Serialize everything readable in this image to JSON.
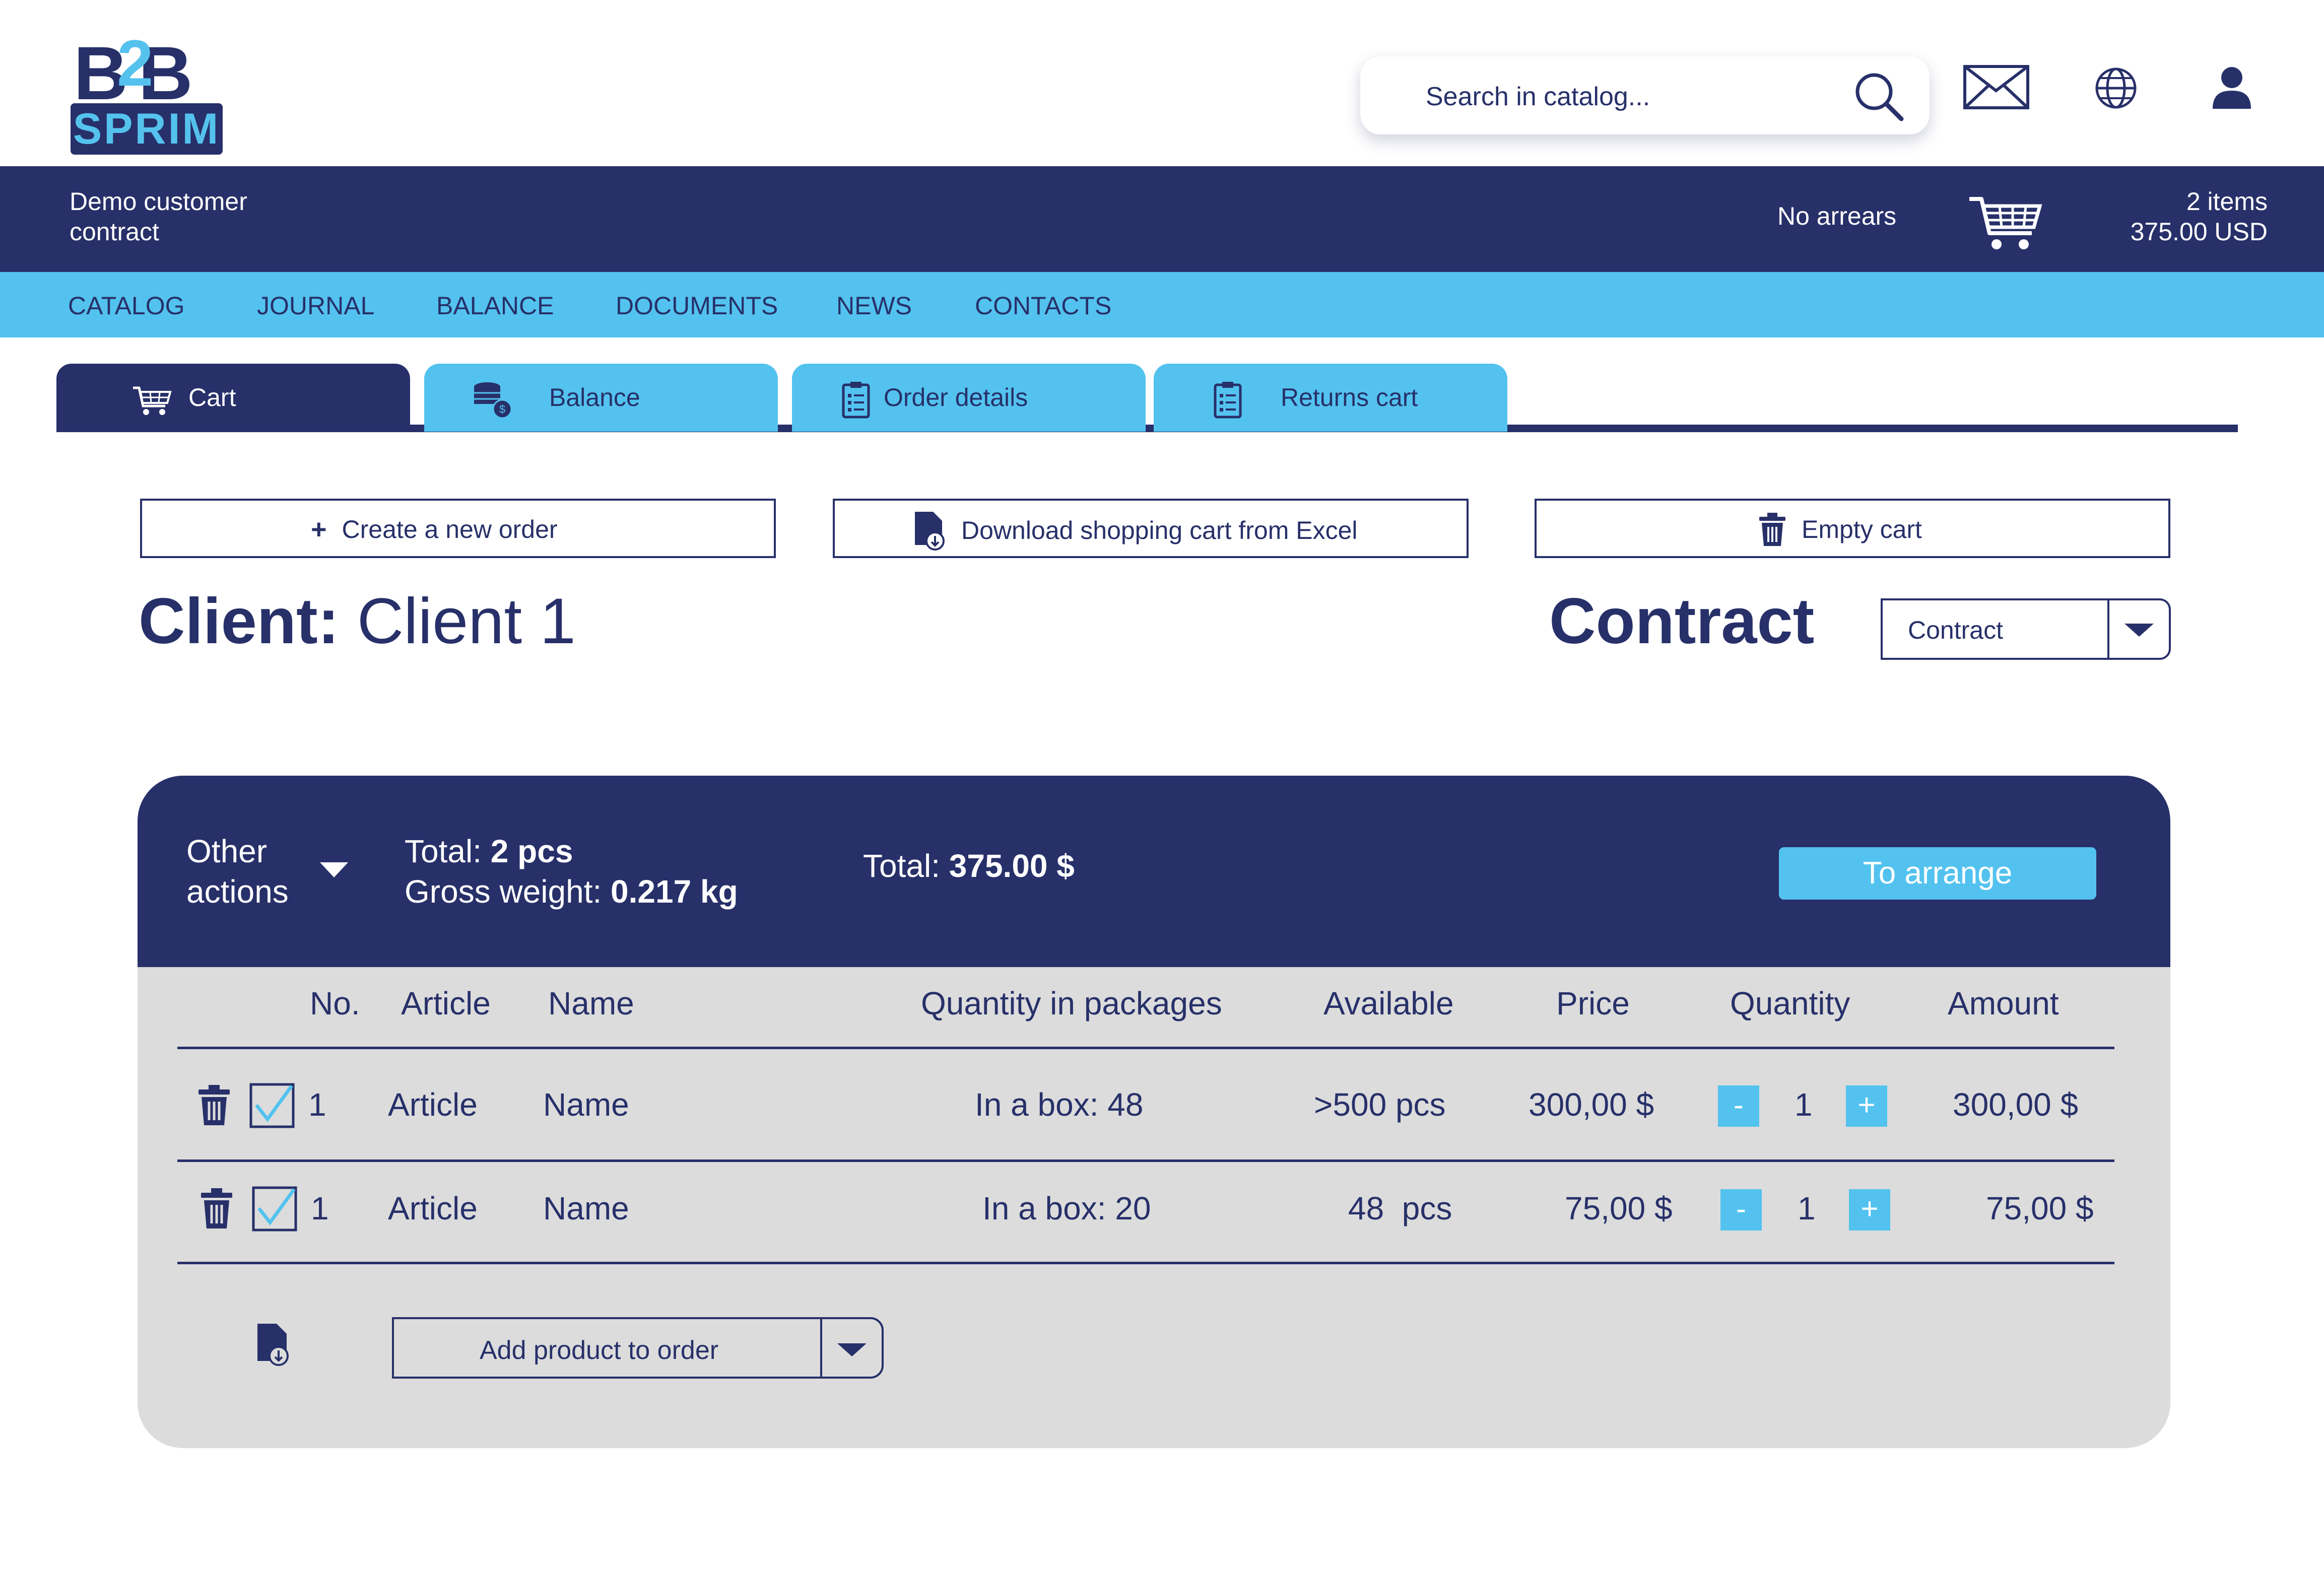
{
  "logo": {
    "top": "B2B",
    "bottom": "SPRIM"
  },
  "search": {
    "placeholder": "Search in catalog..."
  },
  "header_icons": [
    "mail-icon",
    "globe-icon",
    "user-icon"
  ],
  "customer_bar": {
    "contract_line1": "Demo customer",
    "contract_line2": "contract",
    "arrears": "No arrears",
    "cart_items": "2 items",
    "cart_total": "375.00 USD"
  },
  "nav": [
    "CATALOG",
    "JOURNAL",
    "BALANCE",
    "DOCUMENTS",
    "NEWS",
    "CONTACTS"
  ],
  "tabs": [
    {
      "label": "Cart",
      "icon": "cart-icon",
      "active": true
    },
    {
      "label": "Balance",
      "icon": "coins-icon",
      "active": false
    },
    {
      "label": "Order details",
      "icon": "clipboard-icon",
      "active": false
    },
    {
      "label": "Returns cart",
      "icon": "clipboard-icon",
      "active": false
    }
  ],
  "actions": {
    "create": "Create a new order",
    "download": "Download shopping cart from Excel",
    "empty": "Empty cart"
  },
  "client": {
    "label": "Client:",
    "value": "Client 1"
  },
  "contract": {
    "label": "Contract",
    "selected": "Contract"
  },
  "summary": {
    "other_line1": "Other",
    "other_line2": "actions",
    "total_pcs_label": "Total:",
    "total_pcs_value": "2 pcs",
    "weight_label": "Gross weight:",
    "weight_value": "0.217 kg",
    "total_sum_label": "Total:",
    "total_sum_value": "375.00 $",
    "arrange_button": "To arrange"
  },
  "table": {
    "headers": {
      "no": "No.",
      "article": "Article",
      "name": "Name",
      "qty_pkg": "Quantity in packages",
      "available": "Available",
      "price": "Price",
      "quantity": "Quantity",
      "amount": "Amount"
    },
    "rows": [
      {
        "no": "1",
        "article": "Article",
        "name": "Name",
        "qty_pkg": "In a box: 48",
        "available": ">500 pcs",
        "price": "300,00 $",
        "quantity": "1",
        "amount": "300,00 $",
        "checked": true
      },
      {
        "no": "1",
        "article": "Article",
        "name": "Name",
        "qty_pkg": "In a box: 20",
        "available": "48  pcs",
        "price": "75,00 $",
        "quantity": "1",
        "amount": "75,00 $",
        "checked": true
      }
    ],
    "stepper": {
      "minus": "-",
      "plus": "+"
    }
  },
  "add_product": {
    "placeholder": "Add product to order"
  },
  "colors": {
    "navy": "#273069",
    "sky": "#53c2ef",
    "panel": "#dcdcdc"
  }
}
